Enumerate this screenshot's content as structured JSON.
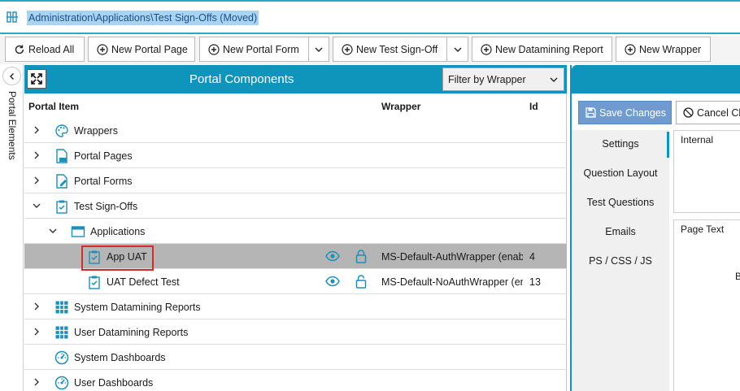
{
  "path": "Administration\\Applications\\Test Sign-Offs (Moved)",
  "toolbar": {
    "reload_all": "Reload All",
    "new_portal_page": "New Portal Page",
    "new_portal_form": "New Portal Form",
    "new_test_signoff": "New Test Sign-Off",
    "new_datamining_report": "New Datamining Report",
    "new_wrapper": "New Wrapper"
  },
  "rail": {
    "label": "Portal Elements"
  },
  "panel": {
    "title": "Portal Components",
    "filter": "Filter by Wrapper",
    "columns": {
      "portal_item": "Portal Item",
      "wrapper": "Wrapper",
      "id": "Id"
    }
  },
  "tree": [
    {
      "label": "Wrappers",
      "icon": "palette-icon",
      "expanded": false,
      "level": 0
    },
    {
      "label": "Portal Pages",
      "icon": "document-doc-icon",
      "expanded": false,
      "level": 0
    },
    {
      "label": "Portal Forms",
      "icon": "form-edit-icon",
      "expanded": false,
      "level": 0
    },
    {
      "label": "Test Sign-Offs",
      "icon": "clipboard-check-icon",
      "expanded": true,
      "level": 0
    },
    {
      "label": "Applications",
      "icon": "window-icon",
      "expanded": true,
      "level": 1
    },
    {
      "label": "App UAT",
      "icon": "clipboard-check-icon",
      "level": 2,
      "selected": true,
      "wrapper": "MS-Default-AuthWrapper (enabled)",
      "id": "4",
      "lock": "locked"
    },
    {
      "label": "UAT Defect Test",
      "icon": "clipboard-check-icon",
      "level": 2,
      "wrapper": "MS-Default-NoAuthWrapper (enabled)",
      "id": "13",
      "lock": "unlocked"
    },
    {
      "label": "System Datamining Reports",
      "icon": "grid-icon",
      "expanded": false,
      "level": 0
    },
    {
      "label": "User Datamining Reports",
      "icon": "grid-icon",
      "expanded": false,
      "level": 0
    },
    {
      "label": "System Dashboards",
      "icon": "dashboard-icon",
      "level": 0
    },
    {
      "label": "User Dashboards",
      "icon": "dashboard-icon",
      "expanded": false,
      "level": 0
    }
  ],
  "detail": {
    "save": "Save Changes",
    "cancel": "Cancel Changes",
    "nav": [
      "Settings",
      "Question Layout",
      "Test Questions",
      "Emails",
      "PS / CSS / JS"
    ],
    "internal": "Internal",
    "page_text": "Page Text",
    "br": "Br"
  },
  "colors": {
    "accent": "#0f95bb",
    "selected_row": "#b5b5b5",
    "highlight": "#d42b2b",
    "save_button": "#6f9bd1",
    "icon_blue": "#1f8fb8"
  }
}
